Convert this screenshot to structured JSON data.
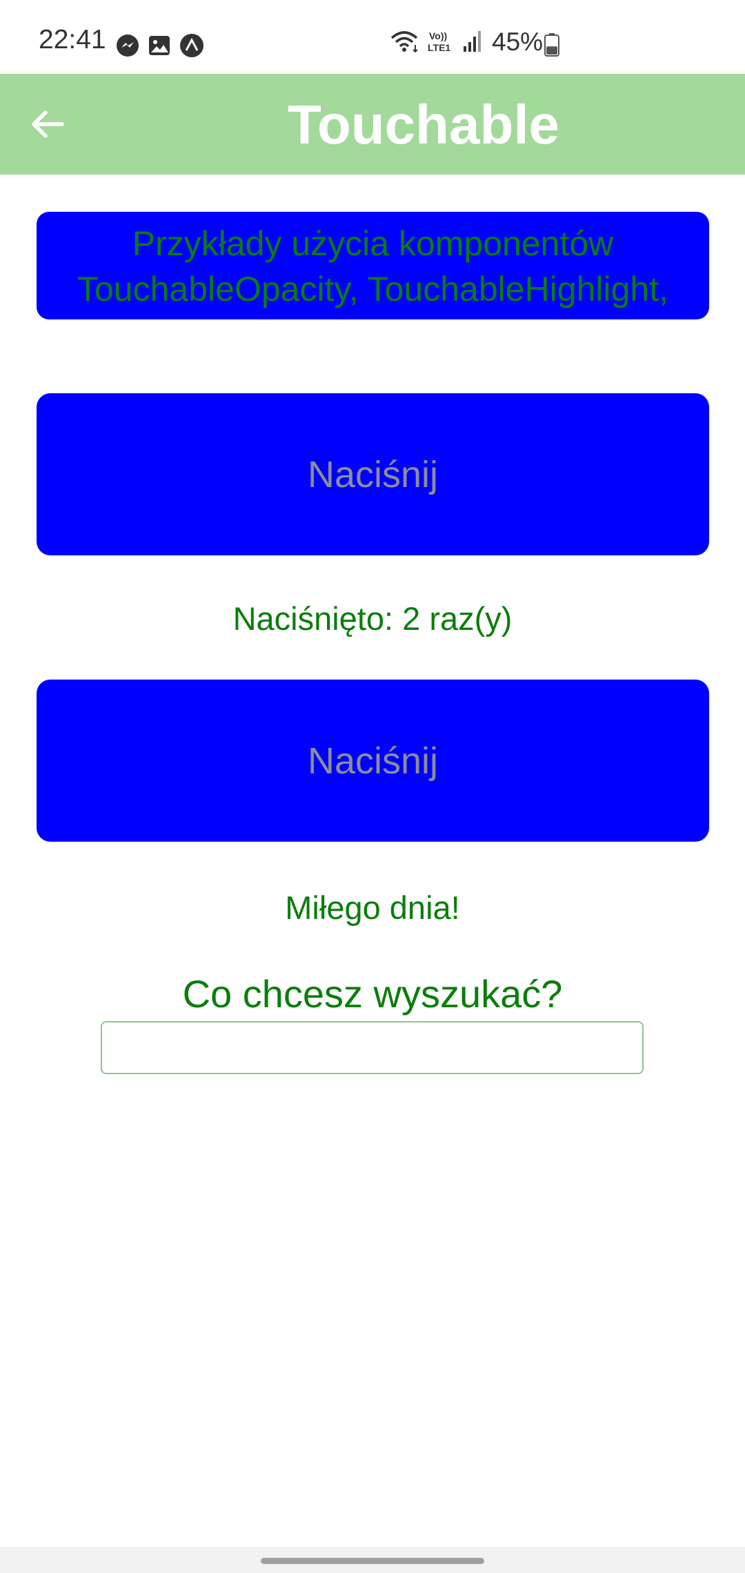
{
  "status_bar": {
    "time": "22:41",
    "left_icons": [
      "messenger-icon",
      "gallery-icon",
      "expo-icon"
    ],
    "right_icons": [
      "wifi-icon",
      "volte-icon",
      "signal-icon"
    ],
    "battery_percent": "45%",
    "battery_level": 0.45
  },
  "header": {
    "title": "Touchable",
    "background_color": "#a3d99b",
    "back_icon": "arrow-left-icon"
  },
  "intro": {
    "text": "Przykłady użycia komponentów TouchableOpacity, TouchableHighlight, TouchableWithoutFeedback"
  },
  "buttons": {
    "first_label": "Naciśnij",
    "second_label": "Naciśnij",
    "color": "#0000ff"
  },
  "counter": {
    "text": "Naciśnięto: 2 raz(y)"
  },
  "greeting": {
    "text": "Miłego dnia!"
  },
  "search": {
    "label": "Co chcesz wyszukać?",
    "value": "",
    "placeholder": ""
  },
  "colors": {
    "text_green": "#0b7d0b",
    "button_label_gray": "#8c8c9a"
  }
}
